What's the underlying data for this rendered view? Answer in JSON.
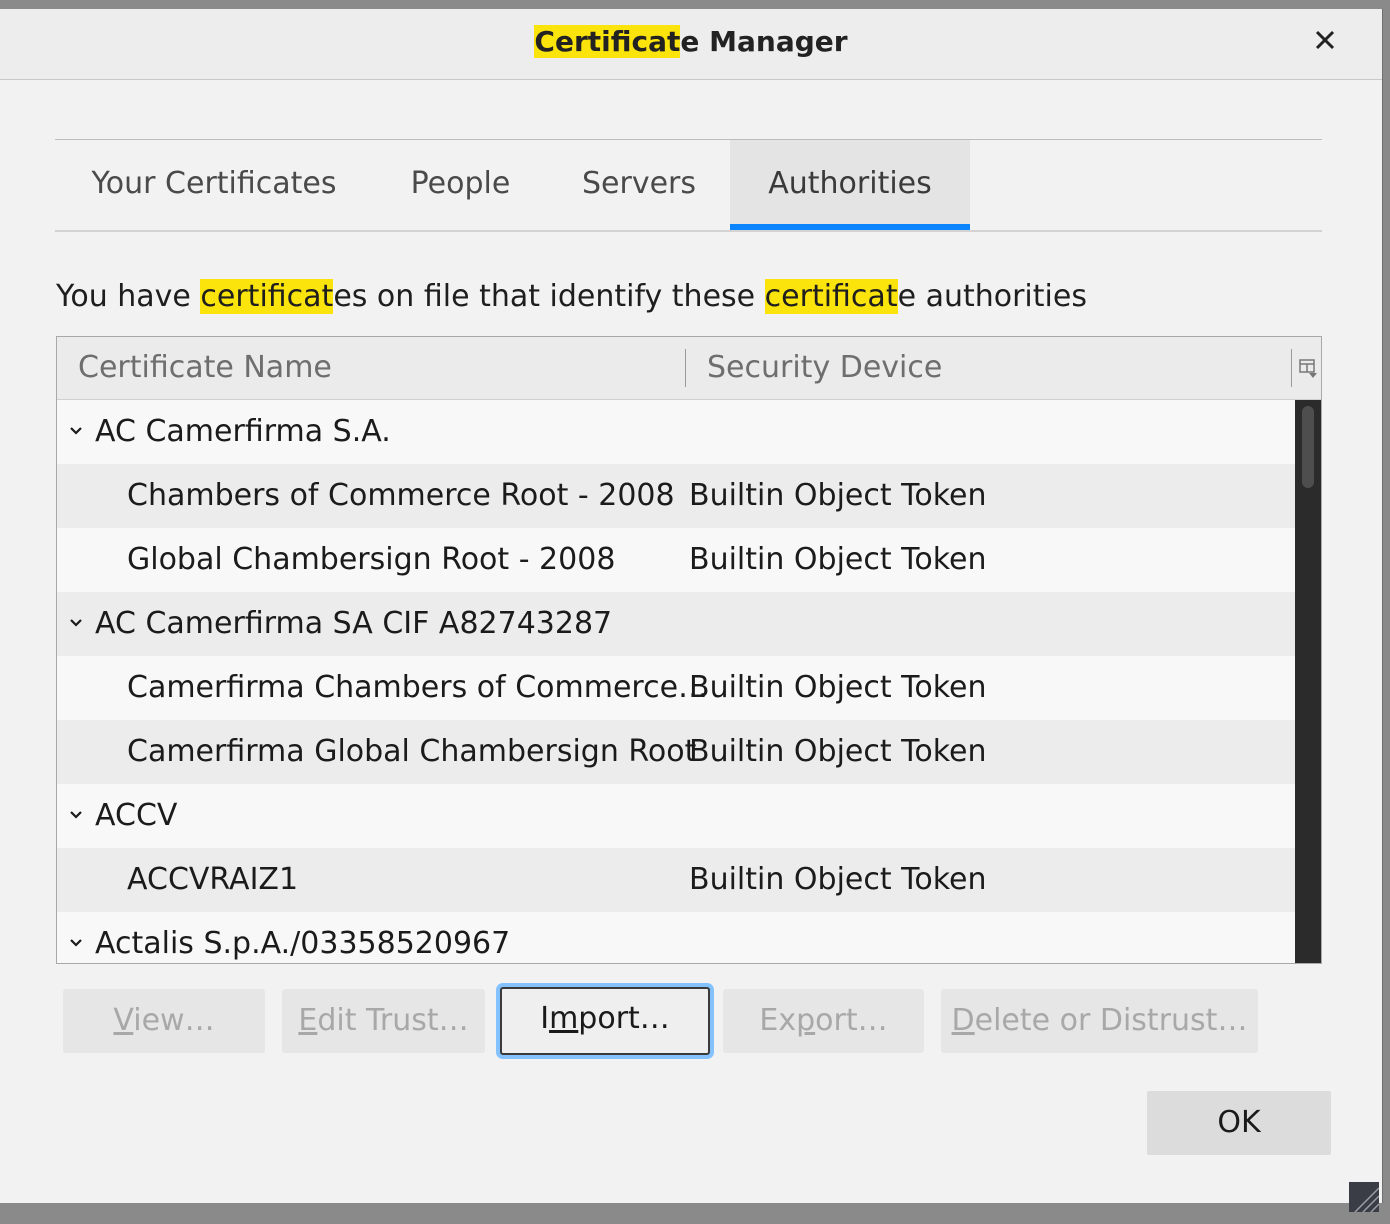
{
  "window": {
    "title_highlight": "Certificat",
    "title_rest": "e Manager",
    "close_glyph": "✕"
  },
  "tabs": [
    {
      "label": "Your Certificates",
      "active": false
    },
    {
      "label": "People",
      "active": false
    },
    {
      "label": "Servers",
      "active": false
    },
    {
      "label": "Authorities",
      "active": true
    }
  ],
  "description": {
    "part1": "You have ",
    "hl1": "certificat",
    "part2": "es on file that identify these ",
    "hl2": "certificat",
    "part3": "e authorities"
  },
  "table": {
    "columns": [
      "Certificate Name",
      "Security Device"
    ],
    "rows": [
      {
        "type": "group",
        "name": "AC Camerfirma S.A.",
        "device": ""
      },
      {
        "type": "item",
        "name": "Chambers of Commerce Root - 2008",
        "device": "Builtin Object Token"
      },
      {
        "type": "item",
        "name": "Global Chambersign Root - 2008",
        "device": "Builtin Object Token"
      },
      {
        "type": "group",
        "name": "AC Camerfirma SA CIF A82743287",
        "device": ""
      },
      {
        "type": "item",
        "name": "Camerfirma Chambers of Commerce…",
        "device": "Builtin Object Token"
      },
      {
        "type": "item",
        "name": "Camerfirma Global Chambersign Root",
        "device": "Builtin Object Token"
      },
      {
        "type": "group",
        "name": "ACCV",
        "device": ""
      },
      {
        "type": "item",
        "name": "ACCVRAIZ1",
        "device": "Builtin Object Token"
      },
      {
        "type": "group",
        "name": "Actalis S.p.A./03358520967",
        "device": ""
      }
    ]
  },
  "buttons": {
    "view": {
      "accel": "V",
      "rest": "iew…",
      "enabled": false
    },
    "edit_trust": {
      "accel": "E",
      "rest": "dit Trust…",
      "enabled": false
    },
    "import": {
      "pre": "I",
      "accel": "m",
      "rest": "port…",
      "enabled": true
    },
    "export": {
      "pre": "Ex",
      "accel": "p",
      "rest": "ort…",
      "enabled": false
    },
    "delete": {
      "accel": "D",
      "rest": "elete or Distrust…",
      "enabled": false
    },
    "ok": "OK"
  },
  "colors": {
    "highlight": "#fbe30c",
    "accent": "#0a84ff",
    "focus_ring": "#84c2ff"
  }
}
